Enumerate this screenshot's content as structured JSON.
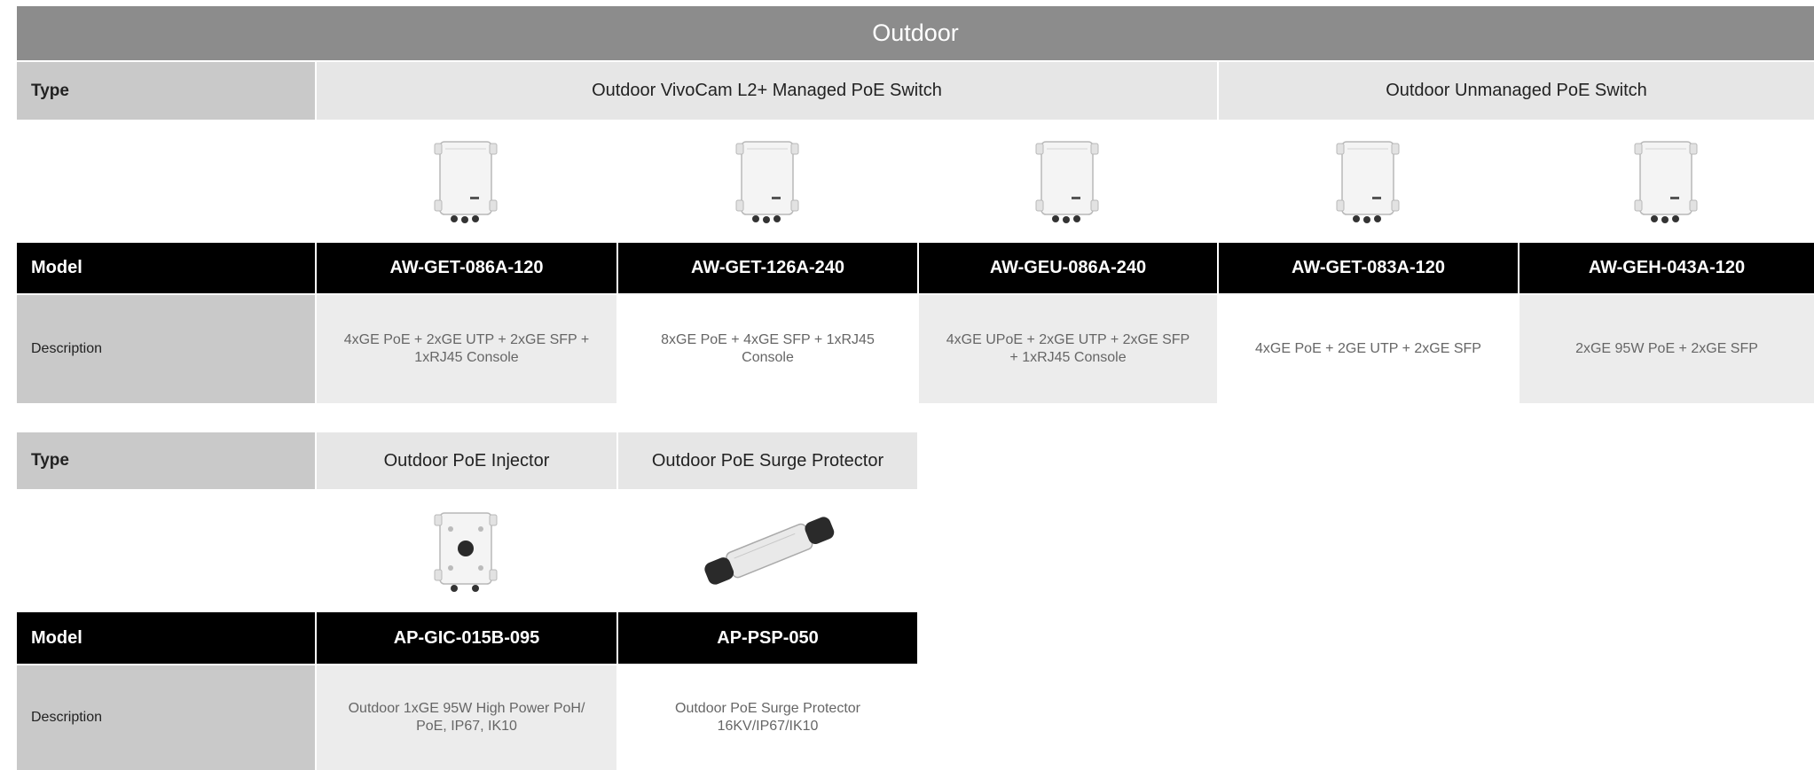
{
  "title": "Outdoor",
  "labels": {
    "type": "Type",
    "model": "Model",
    "description": "Description"
  },
  "table1": {
    "types": [
      {
        "label": "Outdoor VivoCam L2+ Managed PoE Switch"
      },
      {
        "label": "Outdoor Unmanaged PoE Switch"
      }
    ],
    "products": [
      {
        "model": "AW-GET-086A-120",
        "description": "4xGE PoE + 2xGE UTP + 2xGE SFP + 1xRJ45 Console",
        "image": "outdoor-switch-enclosure-icon"
      },
      {
        "model": "AW-GET-126A-240",
        "description": "8xGE PoE + 4xGE SFP + 1xRJ45 Console",
        "image": "outdoor-switch-enclosure-icon"
      },
      {
        "model": "AW-GEU-086A-240",
        "description": "4xGE UPoE + 2xGE UTP + 2xGE SFP + 1xRJ45 Console",
        "image": "outdoor-switch-enclosure-icon"
      },
      {
        "model": "AW-GET-083A-120",
        "description": "4xGE PoE + 2GE UTP + 2xGE SFP",
        "image": "outdoor-switch-enclosure-icon"
      },
      {
        "model": "AW-GEH-043A-120",
        "description": "2xGE 95W PoE + 2xGE SFP",
        "image": "outdoor-switch-enclosure-icon"
      }
    ]
  },
  "table2": {
    "types": [
      {
        "label": "Outdoor PoE Injector"
      },
      {
        "label": "Outdoor PoE Surge Protector"
      }
    ],
    "products": [
      {
        "model": "AP-GIC-015B-095",
        "description": "Outdoor 1xGE 95W High Power PoH/ PoE, IP67, IK10",
        "image": "poe-injector-icon"
      },
      {
        "model": "AP-PSP-050",
        "description": "Outdoor PoE Surge Protector 16KV/IP67/IK10",
        "image": "surge-protector-icon"
      }
    ]
  },
  "colors": {
    "title_bar": "#8c8c8c",
    "label_column": "#c9c9c9",
    "type_cell": "#e6e6e6",
    "model_row": "#000000",
    "desc_shade": "#ececec"
  }
}
